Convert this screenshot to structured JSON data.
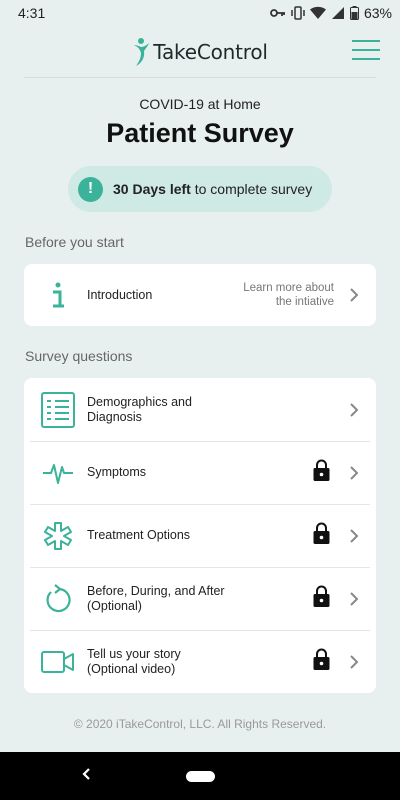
{
  "status_bar": {
    "time": "4:31",
    "battery": "63%"
  },
  "header": {
    "brand": "TakeControl"
  },
  "hero": {
    "subtitle": "COVID-19 at Home",
    "title": "Patient Survey",
    "days_left": "30 Days left",
    "days_suffix": "to complete survey"
  },
  "intro_section": {
    "label": "Before you start",
    "item": {
      "label": "Introduction",
      "note": "Learn more about\nthe intiative",
      "icon": "info-icon"
    }
  },
  "survey_section": {
    "label": "Survey questions",
    "items": [
      {
        "label": "Demographics and\nDiagnosis",
        "icon": "checklist-icon",
        "locked": false
      },
      {
        "label": "Symptoms",
        "icon": "pulse-icon",
        "locked": true
      },
      {
        "label": "Treatment Options",
        "icon": "medical-cross-icon",
        "locked": true
      },
      {
        "label": "Before, During, and After\n(Optional)",
        "icon": "refresh-icon",
        "locked": true
      },
      {
        "label": "Tell us your story\n(Optional video)",
        "icon": "video-icon",
        "locked": true
      }
    ]
  },
  "footer": {
    "copyright": "© 2020 iTakeControl, LLC. All Rights Reserved."
  },
  "colors": {
    "accent": "#3bb29a",
    "background": "#e8f0ef",
    "pill": "#cfe9e5"
  }
}
